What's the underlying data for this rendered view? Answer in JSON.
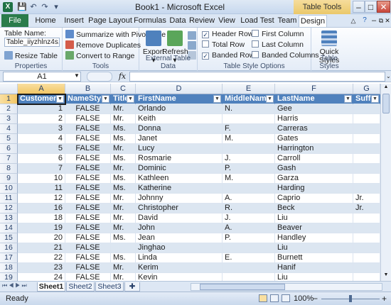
{
  "titlebar": {
    "title": "Book1 - Microsoft Excel",
    "contextual": "Table Tools",
    "min": "–",
    "max": "□",
    "close": "✕",
    "qat": [
      "💾",
      "↶",
      "↷",
      "▾"
    ]
  },
  "tabs": [
    "File",
    "Home",
    "Insert",
    "Page Layout",
    "Formulas",
    "Data",
    "Review",
    "View",
    "Load Test",
    "Team",
    "Design"
  ],
  "ribbon": {
    "properties": {
      "label": "Properties",
      "name_label": "Table Name:",
      "name_value": "Table_iiyzhlnz4s...",
      "resize": "Resize Table"
    },
    "tools": {
      "label": "Tools",
      "summarize": "Summarize with PivotTable",
      "remove_dup": "Remove Duplicates",
      "convert": "Convert to Range"
    },
    "external": {
      "label": "External Table Data",
      "export": "Export",
      "refresh": "Refresh"
    },
    "style_options": {
      "label": "Table Style Options",
      "header_row": "Header Row",
      "total_row": "Total Row",
      "banded_rows": "Banded Rows",
      "first_column": "First Column",
      "last_column": "Last Column",
      "banded_columns": "Banded Columns",
      "checked": {
        "header_row": true,
        "total_row": false,
        "banded_rows": true,
        "first_column": false,
        "last_column": false,
        "banded_columns": false
      }
    },
    "styles": {
      "label": "Table Styles",
      "quick": "Quick",
      "styles": "Styles"
    }
  },
  "formula_bar": {
    "name_box": "A1",
    "fx": "fx",
    "value": ""
  },
  "columns": [
    "A",
    "B",
    "C",
    "D",
    "E",
    "F",
    "G"
  ],
  "header": [
    "CustomerID",
    "NameStyle",
    "Title",
    "FirstName",
    "MiddleName",
    "LastName",
    "Suffix"
  ],
  "rows": [
    [
      "1",
      "FALSE",
      "Mr.",
      "Orlando",
      "N.",
      "Gee",
      ""
    ],
    [
      "2",
      "FALSE",
      "Mr.",
      "Keith",
      "",
      "Harris",
      ""
    ],
    [
      "3",
      "FALSE",
      "Ms.",
      "Donna",
      "F.",
      "Carreras",
      ""
    ],
    [
      "4",
      "FALSE",
      "Ms.",
      "Janet",
      "M.",
      "Gates",
      ""
    ],
    [
      "5",
      "FALSE",
      "Mr.",
      "Lucy",
      "",
      "Harrington",
      ""
    ],
    [
      "6",
      "FALSE",
      "Ms.",
      "Rosmarie",
      "J.",
      "Carroll",
      ""
    ],
    [
      "7",
      "FALSE",
      "Mr.",
      "Dominic",
      "P.",
      "Gash",
      ""
    ],
    [
      "10",
      "FALSE",
      "Ms.",
      "Kathleen",
      "M.",
      "Garza",
      ""
    ],
    [
      "11",
      "FALSE",
      "Ms.",
      "Katherine",
      "",
      "Harding",
      ""
    ],
    [
      "12",
      "FALSE",
      "Mr.",
      "Johnny",
      "A.",
      "Caprio",
      "Jr."
    ],
    [
      "16",
      "FALSE",
      "Mr.",
      "Christopher",
      "R.",
      "Beck",
      "Jr."
    ],
    [
      "18",
      "FALSE",
      "Mr.",
      "David",
      "J.",
      "Liu",
      ""
    ],
    [
      "19",
      "FALSE",
      "Mr.",
      "John",
      "A.",
      "Beaver",
      ""
    ],
    [
      "20",
      "FALSE",
      "Ms.",
      "Jean",
      "P.",
      "Handley",
      ""
    ],
    [
      "21",
      "FALSE",
      "",
      "Jinghao",
      "",
      "Liu",
      ""
    ],
    [
      "22",
      "FALSE",
      "Ms.",
      "Linda",
      "E.",
      "Burnett",
      ""
    ],
    [
      "23",
      "FALSE",
      "Mr.",
      "Kerim",
      "",
      "Hanif",
      ""
    ],
    [
      "24",
      "FALSE",
      "Mr.",
      "Kevin",
      "",
      "Liu",
      ""
    ]
  ],
  "row_numbers": [
    "1",
    "2",
    "3",
    "4",
    "5",
    "6",
    "7",
    "8",
    "9",
    "10",
    "11",
    "12",
    "13",
    "14",
    "15",
    "16",
    "17",
    "18",
    "19"
  ],
  "sheets": [
    "Sheet1",
    "Sheet2",
    "Sheet3"
  ],
  "status": {
    "ready": "Ready",
    "zoom": "100%",
    "zoom_minus": "−",
    "zoom_plus": "+"
  }
}
